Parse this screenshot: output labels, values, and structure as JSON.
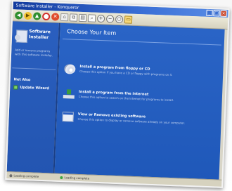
{
  "window": {
    "title": "Software Installer",
    "subtitle": "Konqueror"
  },
  "toolbar": {
    "buttons": [
      {
        "name": "back-icon",
        "glyph": "◀"
      },
      {
        "name": "forward-icon",
        "glyph": "▶"
      },
      {
        "name": "up-icon",
        "glyph": "▲"
      },
      {
        "name": "reload-icon",
        "glyph": "↻"
      },
      {
        "name": "stop-icon",
        "glyph": "✕"
      },
      {
        "name": "home-icon",
        "glyph": "⌂"
      },
      {
        "name": "copy-icon",
        "glyph": "⧉"
      },
      {
        "name": "print-icon",
        "glyph": "▤"
      },
      {
        "name": "search-icon",
        "glyph": "⌕"
      },
      {
        "name": "zoom-in-icon",
        "glyph": "+"
      },
      {
        "name": "zoom-out-icon",
        "glyph": "−"
      },
      {
        "name": "zoom-reset-icon",
        "glyph": "○"
      },
      {
        "name": "folder-icon",
        "glyph": "▭"
      }
    ]
  },
  "sidebar": {
    "title": "Software Installer",
    "description": "Add or remove programs with this software installer.",
    "section_label": "Net Also",
    "link_label": "Update Wizard"
  },
  "main": {
    "heading": "Choose Your Item",
    "options": [
      {
        "title": "Install a program from floppy or CD",
        "desc": "Choose this option if you have a CD or floppy with programs on it."
      },
      {
        "title": "Install a program from the internet",
        "desc": "Choose this option to search on the internet for programs to install."
      },
      {
        "title": "View or Remove existing software",
        "desc": "Choose this option to display or remove software already on your computer."
      }
    ]
  },
  "statusbar": {
    "left": "Loading complete",
    "right": "Loading complete"
  }
}
